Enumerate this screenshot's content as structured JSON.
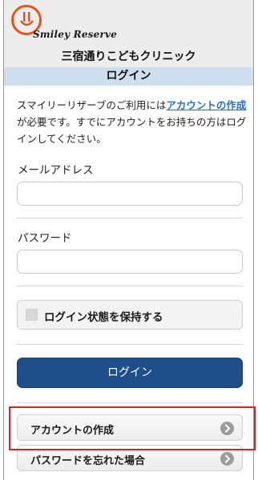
{
  "header": {
    "logo_text": "Smiley Reserve",
    "clinic_name": "三宿通りこどもクリニック",
    "page_title": "ログイン"
  },
  "intro": {
    "text_before": "スマイリーリザーブのご利用には",
    "link_text": "アカウントの作成",
    "text_after": "が必要です。すでにアカウントをお持ちの方はログインしてください。"
  },
  "form": {
    "email_label": "メールアドレス",
    "email_value": "",
    "password_label": "パスワード",
    "password_value": "",
    "remember_label": "ログイン状態を保持する",
    "remember_checked": false,
    "login_button": "ログイン"
  },
  "links": [
    {
      "label": "アカウントの作成",
      "icon": "chevron-right-icon"
    },
    {
      "label": "パスワードを忘れた場合",
      "icon": "chevron-right-icon"
    }
  ],
  "colors": {
    "logo_orange": "#e8531a",
    "title_bar": "#cfdff0",
    "link_blue": "#2a6fc4",
    "button_blue": "#1f4f8a",
    "highlight_red": "#e01e24"
  }
}
